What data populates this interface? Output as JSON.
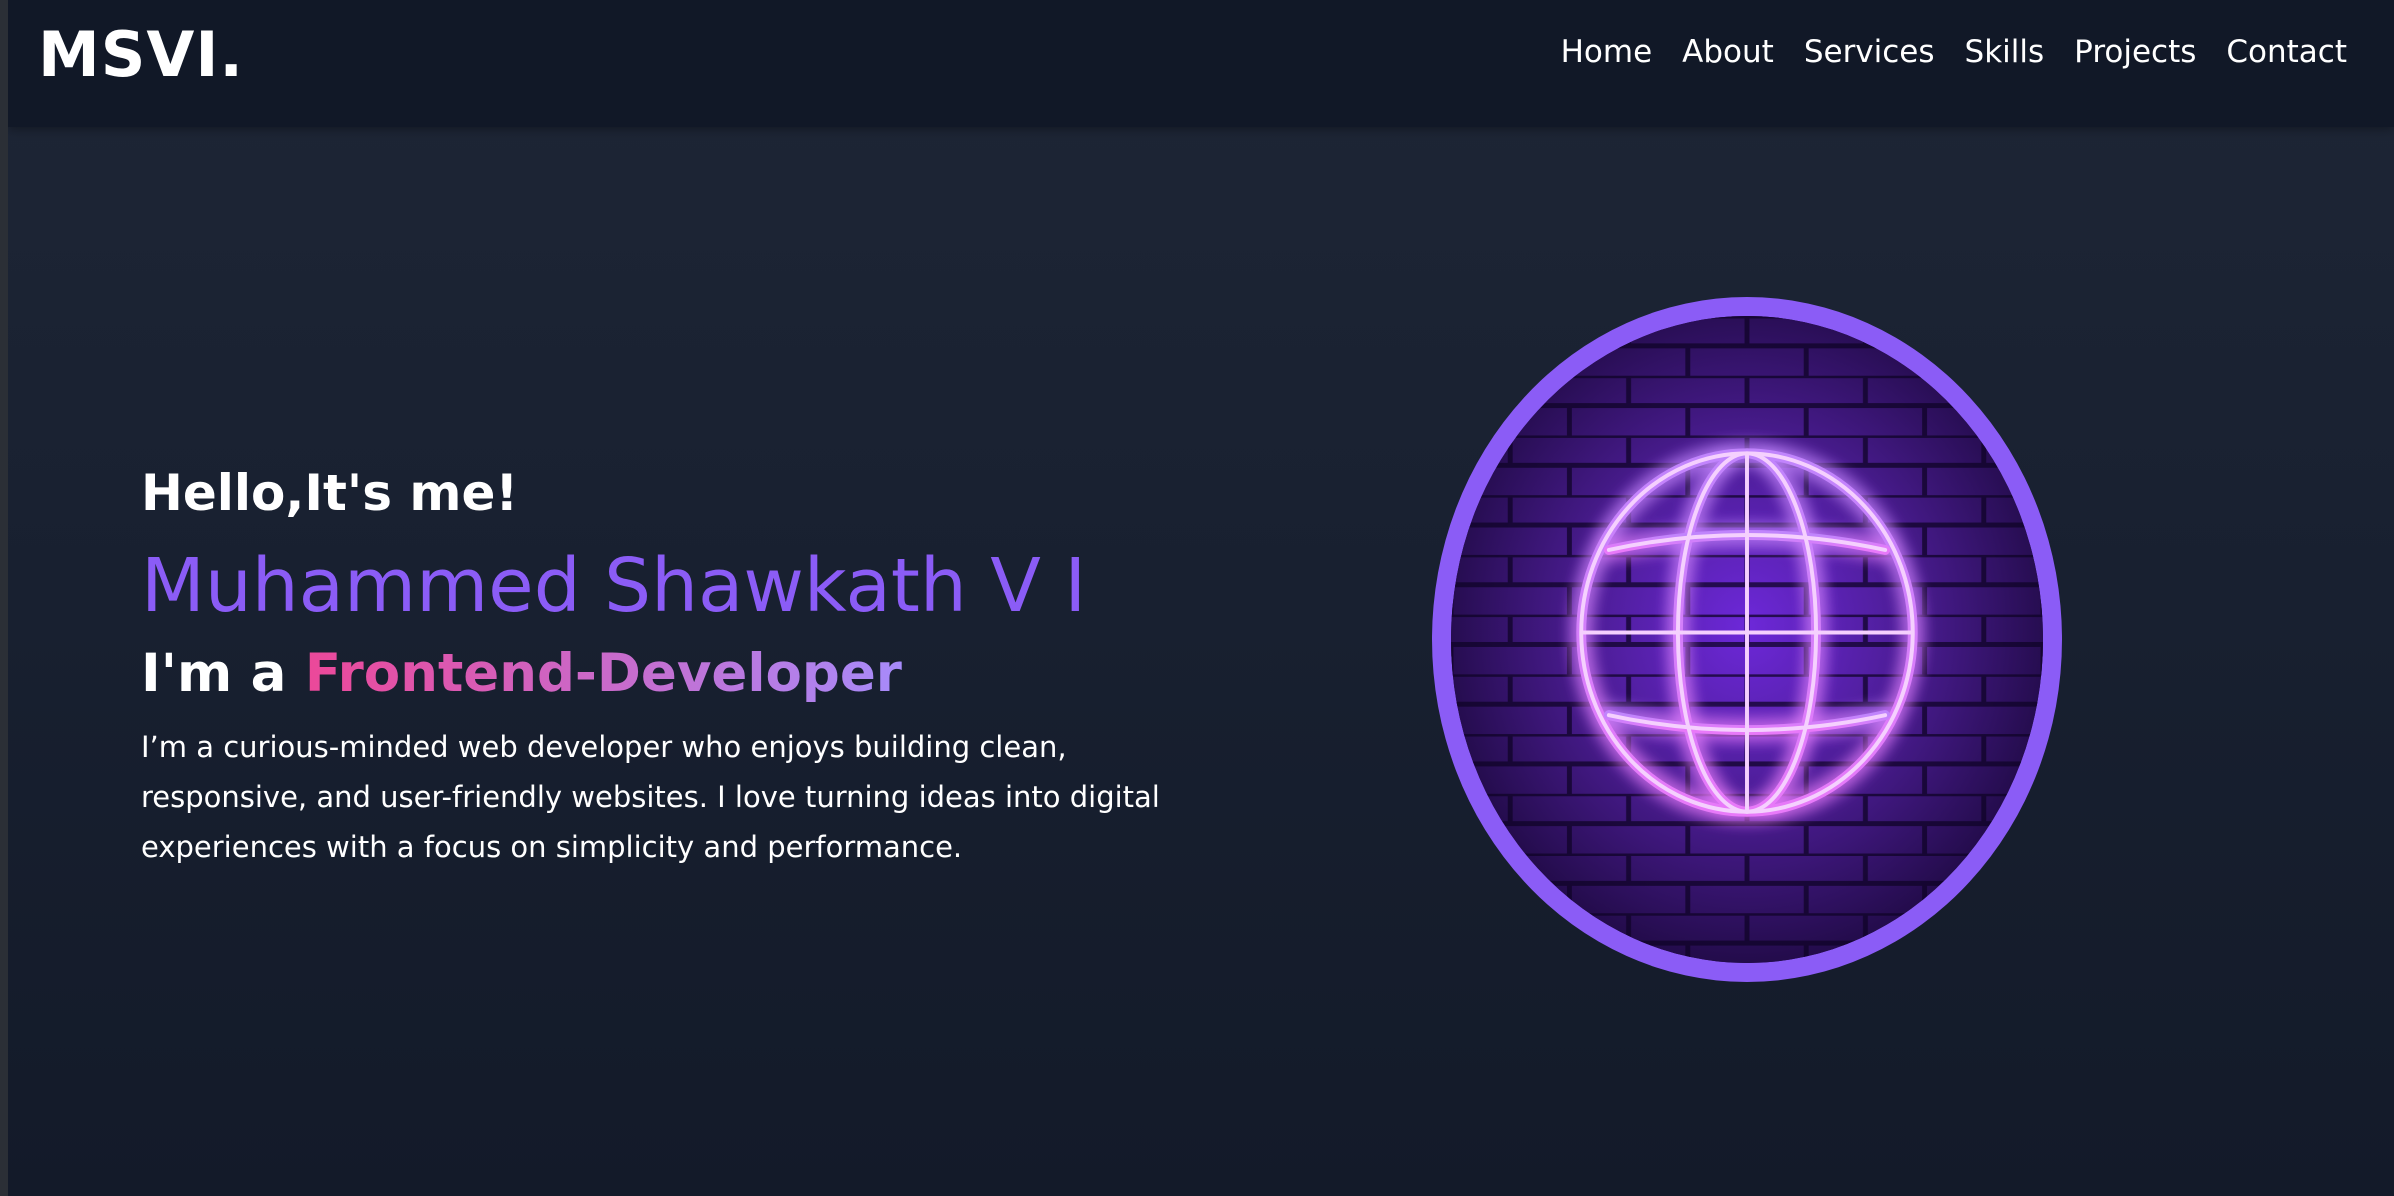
{
  "brand": {
    "logo": "MSVI."
  },
  "nav": {
    "items": [
      {
        "label": "Home"
      },
      {
        "label": "About"
      },
      {
        "label": "Services"
      },
      {
        "label": "Skills"
      },
      {
        "label": "Projects"
      },
      {
        "label": "Contact"
      }
    ]
  },
  "hero": {
    "greeting": "Hello,It's me!",
    "name": "Muhammed Shawkath V I",
    "role_prefix": "I'm a ",
    "role_highlight": "Frontend-Developer",
    "bio": "I’m a curious-minded web developer who enjoys building clean, responsive, and user-friendly websites. I love turning ideas into digital experiences with a focus on simplicity and performance.",
    "image_icon": "neon-globe-icon"
  },
  "colors": {
    "accent": "#8b5cf6",
    "pink": "#ec4899",
    "navbar_bg": "#111827",
    "page_bg": "#1a2232"
  }
}
